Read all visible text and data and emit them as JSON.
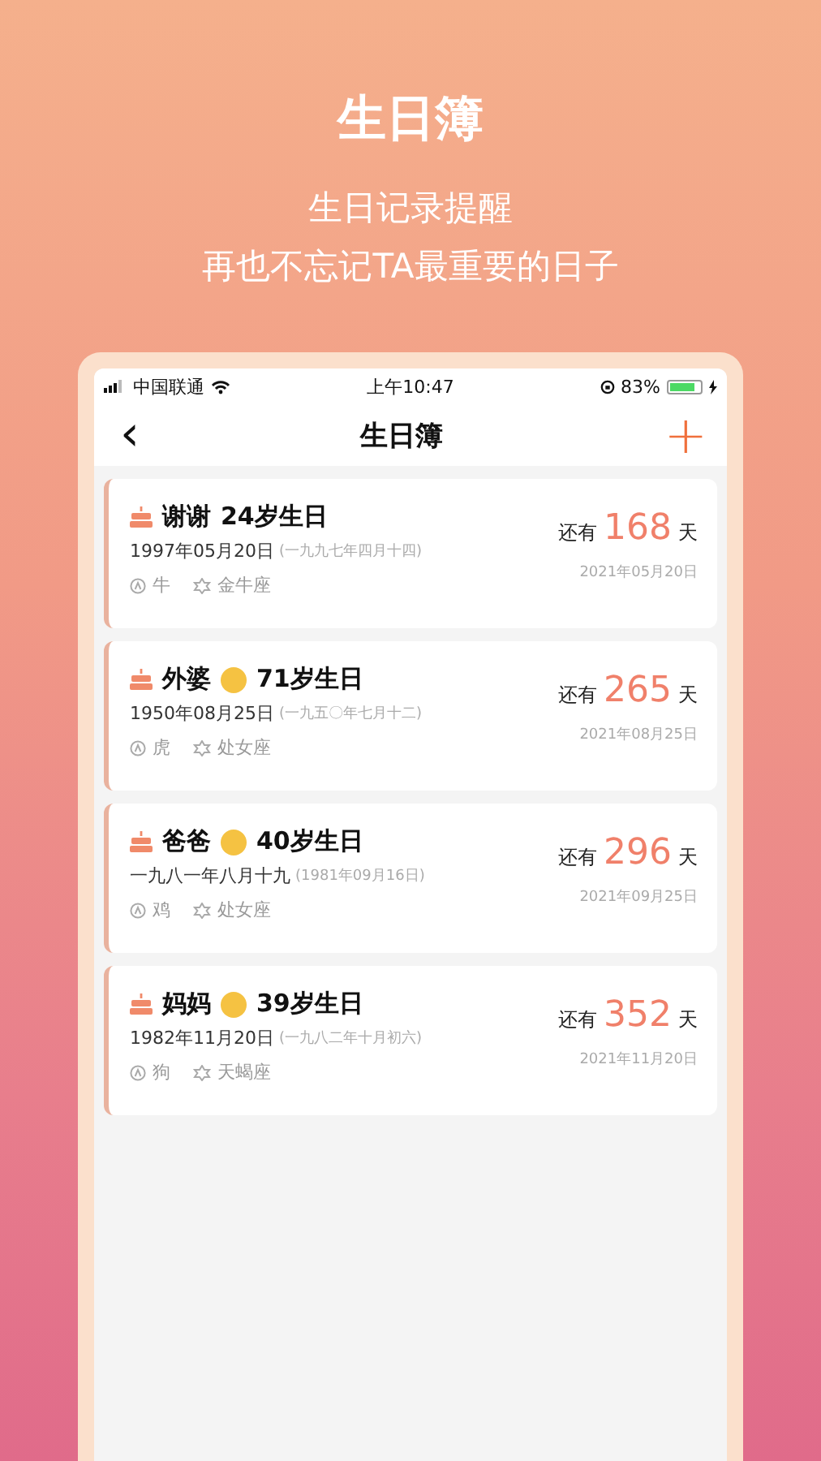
{
  "header": {
    "title": "生日簿",
    "subtitle_lines": [
      "生日记录提醒",
      "再也不忘记TA最重要的日子"
    ]
  },
  "status_bar": {
    "carrier": "中国联通",
    "time": "上午10:47",
    "battery": "83%"
  },
  "nav": {
    "back": "‹",
    "title": "生日簿",
    "add": "+"
  },
  "birthdays": [
    {
      "name": "谢谢",
      "avatar": false,
      "age": "24岁生日",
      "date": "1997年05月20日",
      "alt_date": "(一九九七年四月十四)",
      "animal": "牛",
      "sign": "金牛座",
      "prefix": "还有",
      "days": "168",
      "unit": "天",
      "next": "2021年05月20日"
    },
    {
      "name": "外婆",
      "avatar": true,
      "age": "71岁生日",
      "date": "1950年08月25日",
      "alt_date": "(一九五〇年七月十二)",
      "animal": "虎",
      "sign": "处女座",
      "prefix": "还有",
      "days": "265",
      "unit": "天",
      "next": "2021年08月25日"
    },
    {
      "name": "爸爸",
      "avatar": true,
      "age": "40岁生日",
      "date": "一九八一年八月十九",
      "alt_date": "(1981年09月16日)",
      "animal": "鸡",
      "sign": "处女座",
      "prefix": "还有",
      "days": "296",
      "unit": "天",
      "next": "2021年09月25日"
    },
    {
      "name": "妈妈",
      "avatar": true,
      "age": "39岁生日",
      "date": "1982年11月20日",
      "alt_date": "(一九八二年十月初六)",
      "animal": "狗",
      "sign": "天蝎座",
      "prefix": "还有",
      "days": "352",
      "unit": "天",
      "next": "2021年11月20日"
    }
  ]
}
